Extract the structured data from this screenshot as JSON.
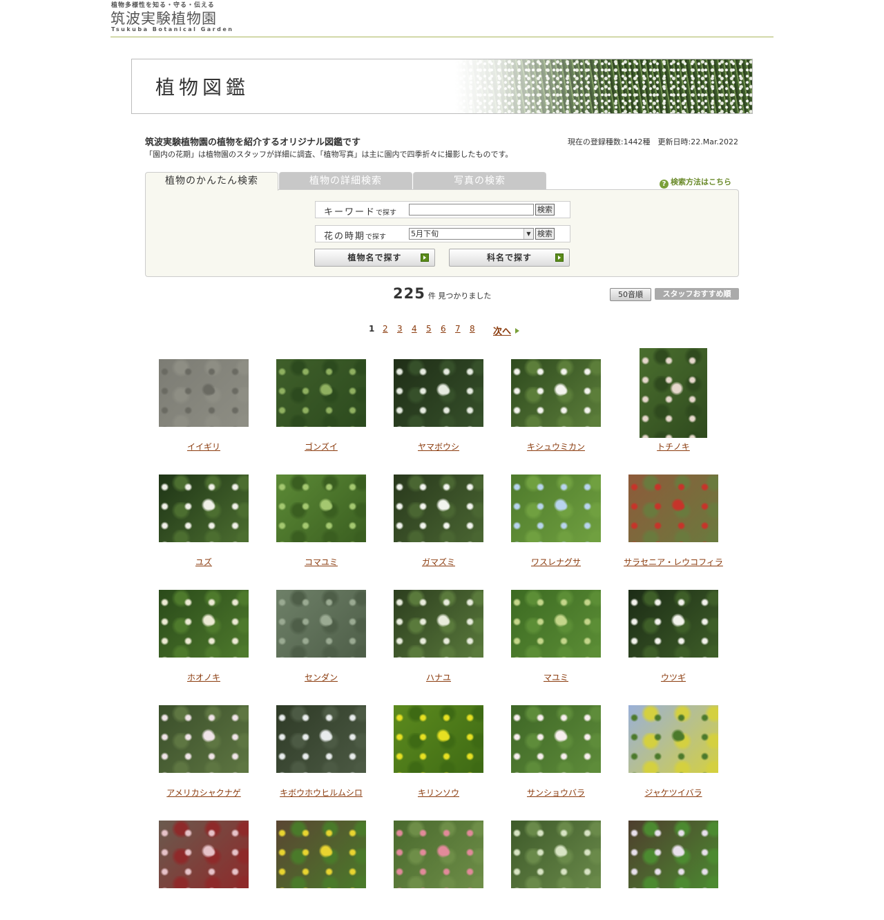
{
  "site": {
    "tagline": "植物多様性を知る・守る・伝える",
    "name": "筑波実験植物園",
    "name_en": "Tsukuba Botanical Garden"
  },
  "banner": {
    "title": "植物図鑑"
  },
  "intro": {
    "heading": "筑波実験植物園の植物を紹介するオリジナル図鑑です",
    "stats": "現在の登録種数:1442種　更新日時:22.Mar.2022",
    "description": "「園内の花期」は植物園のスタッフが詳細に調査、「植物写真」は主に園内で四季折々に撮影したものです。"
  },
  "tabs": [
    {
      "label": "植物のかんたん検索",
      "active": true
    },
    {
      "label": "植物の詳細検索",
      "active": false
    },
    {
      "label": "写真の検索",
      "active": false
    }
  ],
  "help_link": "検索方法はこちら",
  "search": {
    "keyword_label": "キーワード",
    "keyword_suffix": "で探す",
    "keyword_value": "",
    "keyword_button": "検索",
    "period_label": "花の時期",
    "period_suffix": "で探す",
    "period_value": "5月下旬",
    "period_button": "検索",
    "name_button": "植物名で探す",
    "family_button": "科名で探す"
  },
  "results": {
    "count": "225",
    "count_suffix": "件 見つかりました",
    "sort_kana": "50音順",
    "sort_staff": "スタッフおすすめ順"
  },
  "pager": {
    "pages": [
      "1",
      "2",
      "3",
      "4",
      "5",
      "6",
      "7",
      "8"
    ],
    "current": "1",
    "next": "次へ"
  },
  "plants": [
    {
      "name": "イイギリ",
      "colors": [
        "#7c7c74",
        "#6a6a62",
        "#8e8e84"
      ]
    },
    {
      "name": "ゴンズイ",
      "colors": [
        "#3f5f2a",
        "#8fb060",
        "#2c4a1e"
      ]
    },
    {
      "name": "ヤマボウシ",
      "colors": [
        "#1f2e17",
        "#e6ebe0",
        "#36502a"
      ]
    },
    {
      "name": "キシュウミカン",
      "colors": [
        "#2e4a1e",
        "#f4f4ee",
        "#5c7e3a"
      ]
    },
    {
      "name": "トチノキ",
      "colors": [
        "#4a6e2e",
        "#e6d8cc",
        "#2f4a1e"
      ]
    },
    {
      "name": "ユズ",
      "colors": [
        "#1e3416",
        "#f0f0e8",
        "#4c6e30"
      ]
    },
    {
      "name": "コマユミ",
      "colors": [
        "#5c8a36",
        "#a4c870",
        "#3a5e20"
      ]
    },
    {
      "name": "ガマズミ",
      "colors": [
        "#28381c",
        "#f2f4ee",
        "#4a6632"
      ]
    },
    {
      "name": "ワスレナグサ",
      "colors": [
        "#4e7a2c",
        "#b8d4ee",
        "#70a040"
      ]
    },
    {
      "name": "サラセニア・レウコフィラ",
      "colors": [
        "#8e5a3a",
        "#c6342a",
        "#6a7a3e"
      ]
    },
    {
      "name": "ホオノキ",
      "colors": [
        "#2a4a1a",
        "#ecead4",
        "#4e7a2c"
      ]
    },
    {
      "name": "センダン",
      "colors": [
        "#6e8068",
        "#9aaa92",
        "#4e5e48"
      ]
    },
    {
      "name": "ハナユ",
      "colors": [
        "#2c3e1e",
        "#e8ecdc",
        "#5a7a3c"
      ]
    },
    {
      "name": "マユミ",
      "colors": [
        "#3c6a22",
        "#c4d68a",
        "#5c8e36"
      ]
    },
    {
      "name": "ウツギ",
      "colors": [
        "#1c2c16",
        "#f2f2ec",
        "#3e5e28"
      ]
    },
    {
      "name": "アメリカシャクナゲ",
      "colors": [
        "#3a4e2a",
        "#f0e4e8",
        "#5e7642"
      ]
    },
    {
      "name": "キボウホウヒルムシロ",
      "colors": [
        "#2e3a26",
        "#e8ecec",
        "#4c5a44"
      ]
    },
    {
      "name": "キリンソウ",
      "colors": [
        "#5c8a1e",
        "#e6e022",
        "#3e6a14"
      ]
    },
    {
      "name": "サンショウバラ",
      "colors": [
        "#3e6626",
        "#f8eeee",
        "#5e8c3a"
      ]
    },
    {
      "name": "ジャケツイバラ",
      "colors": [
        "#9ab0d8",
        "#4c7a2c",
        "#d4d040"
      ]
    },
    {
      "name": "",
      "colors": [
        "#6a5a4e",
        "#e6c2c8",
        "#8e2a2a"
      ]
    },
    {
      "name": "",
      "colors": [
        "#5a4632",
        "#e8d430",
        "#4a7a2a"
      ]
    },
    {
      "name": "",
      "colors": [
        "#4a6a2e",
        "#e28a9a",
        "#6e8e48"
      ]
    },
    {
      "name": "",
      "colors": [
        "#3e5a2a",
        "#d8e4c4",
        "#6a8a4a"
      ]
    },
    {
      "name": "",
      "colors": [
        "#4e3e2e",
        "#e8e0ec",
        "#4c8a30"
      ]
    }
  ]
}
